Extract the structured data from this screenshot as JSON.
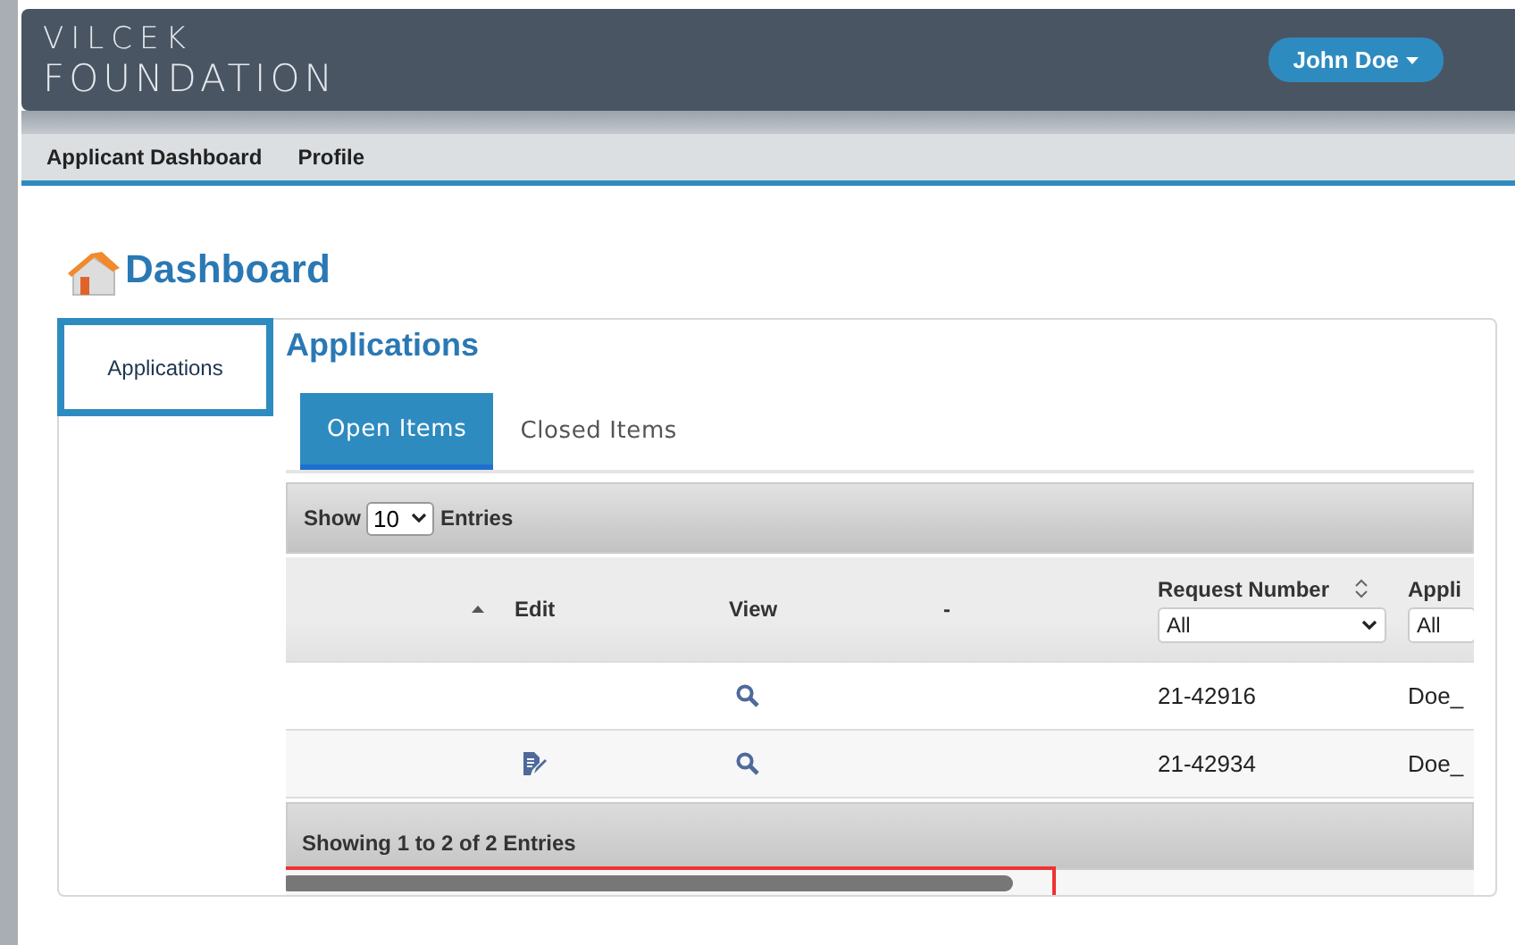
{
  "header": {
    "logo_lines": [
      "VILCEK",
      "FOUNDATION"
    ],
    "user_menu": "John Doe"
  },
  "nav": [
    {
      "label": "Applicant Dashboard"
    },
    {
      "label": "Profile"
    }
  ],
  "page_title": "Dashboard",
  "sidebar": {
    "items": [
      {
        "label": "Applications",
        "selected": true
      }
    ]
  },
  "section_title": "Applications",
  "tabs": [
    {
      "label": "Open Items",
      "selected": true
    },
    {
      "label": "Closed Items",
      "selected": false
    }
  ],
  "table": {
    "length_control": {
      "before": "Show",
      "value": "10",
      "after": "Entries"
    },
    "columns": [
      {
        "sorted_ascending": true,
        "sortable": false
      },
      {
        "label": "Edit",
        "sorted_ascending": false,
        "sortable": false
      },
      {
        "label": "View",
        "sorted_ascending": false,
        "sortable": false
      },
      {
        "label": "-",
        "sorted_ascending": false,
        "sortable": false
      },
      {
        "label": "Request Number",
        "sorted_ascending": false,
        "sortable": true,
        "filter": "All"
      },
      {
        "label": "Appli",
        "sorted_ascending": false,
        "sortable": false,
        "filter": "All"
      }
    ],
    "rows": [
      {
        "editable": false,
        "request_number": "21-42916",
        "applicant": "Doe_"
      },
      {
        "editable": true,
        "request_number": "21-42934",
        "applicant": "Doe_"
      }
    ],
    "footer": "Showing 1 to 2 of 2 Entries"
  }
}
